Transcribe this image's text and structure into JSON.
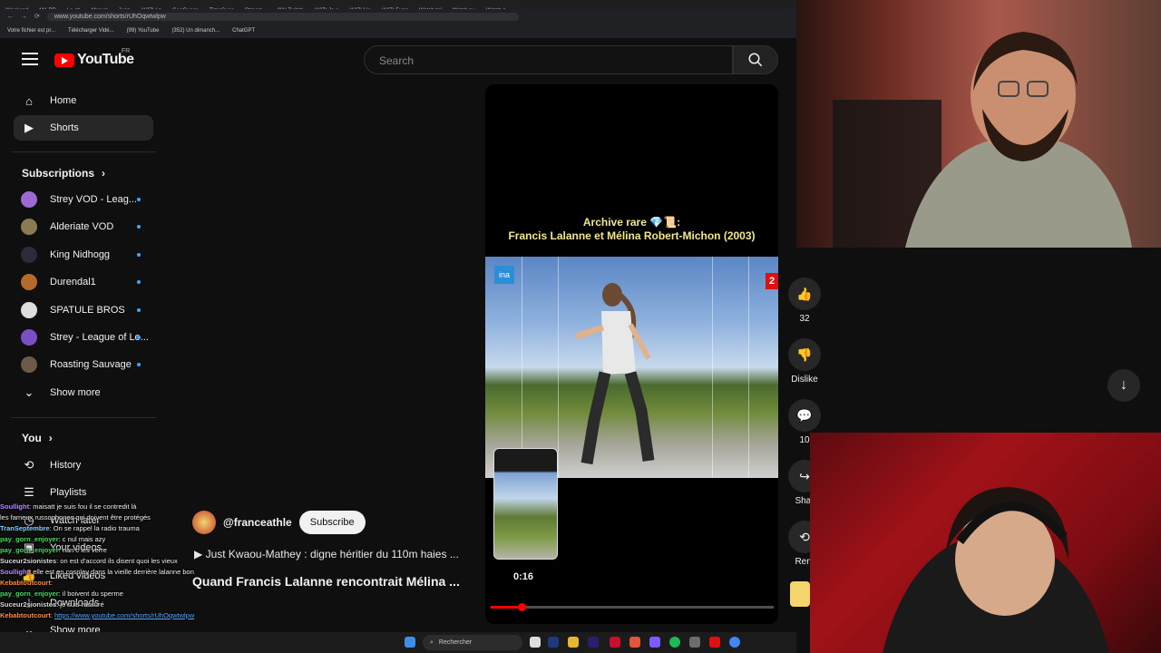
{
  "browser": {
    "tabs": [
      "Weekend",
      "MA PR",
      "Le ch",
      "Marvel",
      "Juan",
      "(127) I n",
      "GeoGuess",
      "TimeGues",
      "Stream -",
      "(91) Twitch",
      "(127) Je s",
      "(127) L'e",
      "(127) Funn",
      "Watch tel",
      "Watch pu",
      "Watch n"
    ],
    "url": "www.youtube.com/shorts/rUhOqwtwlpw",
    "bookmarks": [
      "Votre fichier est pr...",
      "Télécharger Vidé...",
      "(99) YouTube",
      "(352) Un dimanch...",
      "ChatGPT"
    ]
  },
  "header": {
    "logo_text": "YouTube",
    "country_code": "FR",
    "search_placeholder": "Search"
  },
  "sidebar": {
    "main": [
      {
        "label": "Home",
        "icon": "home-icon"
      },
      {
        "label": "Shorts",
        "icon": "shorts-icon",
        "active": true
      }
    ],
    "subscriptions_title": "Subscriptions",
    "subscriptions": [
      {
        "label": "Strey VOD - Leag...",
        "color": "#9c6ad1"
      },
      {
        "label": "Alderiate VOD",
        "color": "#8a7b52"
      },
      {
        "label": "King Nidhogg",
        "color": "#2b2b3a"
      },
      {
        "label": "Durendal1",
        "color": "#b46a2a"
      },
      {
        "label": "SPATULE BROS",
        "color": "#dddddd"
      },
      {
        "label": "Strey - League of Le...",
        "color": "#7b4fc4"
      },
      {
        "label": "Roasting Sauvage",
        "color": "#6b5a48"
      }
    ],
    "show_more": "Show more",
    "you_title": "You",
    "you_items": [
      {
        "label": "History",
        "icon": "history-icon"
      },
      {
        "label": "Playlists",
        "icon": "playlists-icon"
      },
      {
        "label": "Watch later",
        "icon": "watch-later-icon"
      },
      {
        "label": "Your videos",
        "icon": "your-videos-icon"
      },
      {
        "label": "Liked videos",
        "icon": "liked-videos-icon"
      },
      {
        "label": "Downloads",
        "icon": "downloads-icon"
      },
      {
        "label": "Show more",
        "icon": "chevron-down-icon"
      }
    ]
  },
  "short": {
    "title_line1": "Archive rare 💎📜:",
    "title_line2": "Francis Lalanne et Mélina Robert-Michon (2003)",
    "ina_logo": "ina",
    "channel_logo": "2",
    "time": "0:16",
    "progress": 0.11
  },
  "actions": {
    "likes": "32",
    "dislike": "Dislike",
    "comments": "10",
    "share": "Shar",
    "remix": "Rem"
  },
  "channel": {
    "name": "@franceathle",
    "subscribe": "Subscribe",
    "playlist_link": "Just Kwaou-Mathey : digne héritier du 110m haies ...",
    "video_title": "Quand Francis Lalanne rencontrait Mélina ..."
  },
  "chat": [
    {
      "user": "Soullight",
      "color": "#b58cff",
      "text": "maisatt je suis fou il se contredit là"
    },
    {
      "user": "",
      "color": "#b58cff",
      "text": "les fameux russophones qui doivent être protégés"
    },
    {
      "user": "TranSeptembre",
      "color": "#7fd3ff",
      "text": "On se rappel la radio trauma"
    },
    {
      "user": "pay_gorn_enjoyer",
      "color": "#3fdc5a",
      "text": "c nul mais azy"
    },
    {
      "user": "pay_gorn_enjoyer",
      "color": "#3fdc5a",
      "text": "nan c les verre"
    },
    {
      "user": "Suceur2sionistes",
      "color": "#d9d9d9",
      "text": "on est d'accord ils disent quoi les vieux"
    },
    {
      "user": "Soullight",
      "color": "#b58cff",
      "text": "elle est en cosplay dans la vieille derrière lalanne bon"
    },
    {
      "user": "Kebabtoutcourt",
      "color": "#ff8c3a",
      "text": ""
    },
    {
      "user": "pay_gorn_enjoyer",
      "color": "#3fdc5a",
      "text": "il boivent du sperme"
    },
    {
      "user": "Suceur2sionistes",
      "color": "#d9d9d9",
      "text": "je suis rassuré"
    },
    {
      "user": "Kebabtoutcourt",
      "color": "#ff8c3a",
      "text": "https://www.youtube.com/shorts/rUhOqwtwlpw",
      "link": true
    }
  ],
  "taskbar": {
    "search_label": "Rechercher"
  }
}
